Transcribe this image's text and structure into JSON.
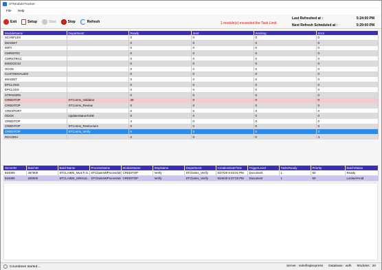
{
  "window": {
    "title": "STModuleTracker"
  },
  "menu": [
    "File",
    "Help"
  ],
  "toolbar": {
    "exit": "Exit",
    "setup": "Setup",
    "start": "Start",
    "stop": "Stop",
    "refresh": "Refresh"
  },
  "alert": "1 module(s) exceeded the Task Limit.",
  "refresh_info": {
    "last_label": "Last Refreshed at :",
    "last_value": "5:24:00 PM",
    "next_label": "Next Refresh Scheduled at :",
    "next_value": "5:29:00 PM"
  },
  "modules": {
    "columns": [
      "ModuleName",
      "Department",
      "Ready",
      "Sent",
      "Working",
      "Error"
    ],
    "rows": [
      {
        "name": "SCANFLEX",
        "dept": "",
        "ready": "0",
        "sent": "0",
        "working": "0",
        "error": "0",
        "style": "odd"
      },
      {
        "name": "IMAGEIT",
        "dept": "",
        "ready": "0",
        "sent": "0",
        "working": "0",
        "error": "0",
        "style": "even"
      },
      {
        "name": "IMITI",
        "dept": "",
        "ready": "0",
        "sent": "0",
        "working": "0",
        "error": "0",
        "style": "odd"
      },
      {
        "name": "CMRGFR2",
        "dept": "",
        "ready": "0",
        "sent": "0",
        "working": "0",
        "error": "0",
        "style": "even"
      },
      {
        "name": "CMRXTRAC",
        "dept": "",
        "ready": "0",
        "sent": "0",
        "working": "0",
        "error": "0",
        "style": "odd"
      },
      {
        "name": "IMGDOCS2",
        "dept": "",
        "ready": "0",
        "sent": "0",
        "working": "0",
        "error": "0",
        "style": "even"
      },
      {
        "name": "OCOS",
        "dept": "",
        "ready": "0",
        "sent": "0",
        "working": "0",
        "error": "0",
        "style": "odd"
      },
      {
        "name": "CUSTOMVALIDS",
        "dept": "",
        "ready": "0",
        "sent": "0",
        "working": "0",
        "error": "0",
        "style": "even"
      },
      {
        "name": "IMAGEIT",
        "dept": "",
        "ready": "0",
        "sent": "0",
        "working": "0",
        "error": "0",
        "style": "odd"
      },
      {
        "name": "EPCLOSS",
        "dept": "",
        "ready": "0",
        "sent": "0",
        "working": "0",
        "error": "0",
        "style": "even"
      },
      {
        "name": "EPCLOSS",
        "dept": "",
        "ready": "0",
        "sent": "0",
        "working": "0",
        "error": "0",
        "style": "odd"
      },
      {
        "name": "STPASSRS",
        "dept": "",
        "ready": "0",
        "sent": "0",
        "working": "0",
        "error": "0",
        "style": "even"
      },
      {
        "name": "CREDITOP",
        "dept": "STCorms_Validator",
        "ready": "30",
        "sent": "0",
        "working": "0",
        "error": "0",
        "style": "exceeded"
      },
      {
        "name": "CREDITOP",
        "dept": "STCorms_Review",
        "ready": "0",
        "sent": "0",
        "working": "0",
        "error": "0",
        "style": "even"
      },
      {
        "name": "CREXPORT",
        "dept": "",
        "ready": "0",
        "sent": "0",
        "working": "0",
        "error": "0",
        "style": "odd"
      },
      {
        "name": "ODOS",
        "dept": "UpdateStatusToDB",
        "ready": "0",
        "sent": "0",
        "working": "0",
        "error": "0",
        "style": "even"
      },
      {
        "name": "CREDITOP",
        "dept": "",
        "ready": "4",
        "sent": "0",
        "working": "0",
        "error": "0",
        "style": "odd"
      },
      {
        "name": "CREDITOP",
        "dept": "STCorms_Restructure",
        "ready": "0",
        "sent": "0",
        "working": "0",
        "error": "0",
        "style": "even"
      },
      {
        "name": "CREDITOP",
        "dept": "STCorms_Verify",
        "ready": "0",
        "sent": "0",
        "working": "0",
        "error": "0",
        "style": "selected"
      },
      {
        "name": "RGCONV",
        "dept": "",
        "ready": "2",
        "sent": "0",
        "working": "0",
        "error": "4",
        "style": "even"
      }
    ]
  },
  "batches": {
    "columns": [
      "ServerID",
      "BatchID",
      "BatchName",
      "ProcessName",
      "ModuleName",
      "StepName",
      "Department",
      "CreationDateTime",
      "TriggerLevel",
      "TasksReady",
      "Priority",
      "BatchStatus"
    ],
    "rows": [
      [
        "924005",
        "467800",
        "STCLAIMS_MULTI S...",
        "STClaimsWProcessW...",
        "CREDITOP",
        "Verify",
        "STClaims_Verify",
        "5/27/20 5:03:01 PM",
        "Document",
        "1",
        "50",
        "Ready"
      ],
      [
        "924005",
        "200000",
        "STCLAIMS_SINGLE...",
        "STClaimsWProcessW...",
        "CREDITOP",
        "Verify",
        "STClaims_Verify",
        "5/26/20 5:37:03 PM",
        "Document",
        "1",
        "50",
        "Locked-Hold"
      ]
    ]
  },
  "status": {
    "message": "Countdown started...",
    "server": "Server : soleil\\sqlexpress",
    "database": "Database : wdh",
    "modules": "Modules : 20"
  }
}
